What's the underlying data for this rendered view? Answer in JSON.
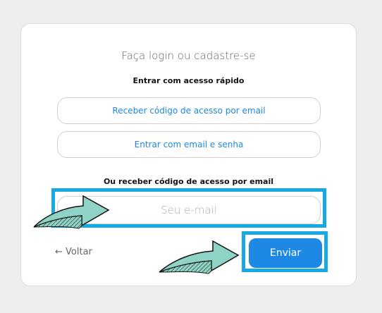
{
  "card": {
    "title": "Faça login ou cadastre-se",
    "subtitle": "Entrar com acesso rápido",
    "option_code_label": "Receber código de acesso por email",
    "option_password_label": "Entrar com email e senha",
    "or_label": "Ou receber código de acesso por email",
    "email_placeholder": "Seu e-mail",
    "email_value": "",
    "back_label": "← Voltar",
    "send_label": "Enviar"
  },
  "annotations": {
    "highlight_color": "#17a9e1",
    "arrow_fill": "#8fd3c7",
    "arrow_icon": "arrow-right-icon"
  },
  "colors": {
    "accent": "#1e88e5",
    "page_background": "#eeeeee"
  }
}
